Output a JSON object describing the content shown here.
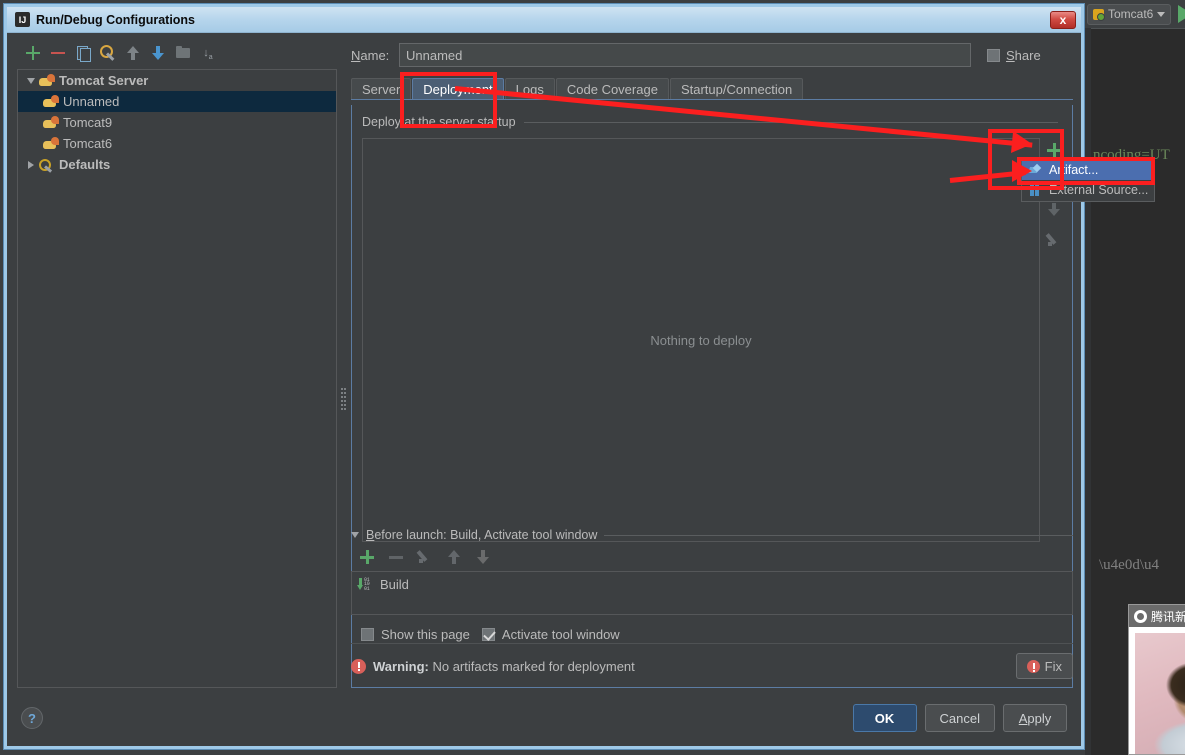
{
  "window": {
    "title": "Run/Debug Configurations",
    "icon": "intellij-idea-icon",
    "close_label": "x"
  },
  "ide_background": {
    "run_config_name": "Tomcat6",
    "run_button": "run-icon",
    "code_lines": [
      {
        "text": "ncoding=UT",
        "color": "#6a8759"
      },
      {
        "text": "\\u4e0d\\u4",
        "color": "#808080"
      }
    ]
  },
  "news_popup": {
    "title": "腾讯新",
    "logo": "tencent-news-logo"
  },
  "left_panel": {
    "toolbar": [
      {
        "name": "add-configuration-button",
        "icon": "plus-icon"
      },
      {
        "name": "remove-configuration-button",
        "icon": "minus-icon"
      },
      {
        "name": "copy-configuration-button",
        "icon": "copy-icon"
      },
      {
        "name": "edit-defaults-button",
        "icon": "wrench-icon"
      },
      {
        "name": "move-up-button",
        "icon": "arrow-up-icon"
      },
      {
        "name": "move-down-button",
        "icon": "arrow-down-icon"
      },
      {
        "name": "create-folder-button",
        "icon": "folder-icon"
      },
      {
        "name": "sort-configurations-button",
        "icon": "sort-az-icon"
      }
    ],
    "tree": [
      {
        "label": "Tomcat Server",
        "icon": "tomcat-icon",
        "level": 0,
        "expanded": true,
        "group": true,
        "selected": false
      },
      {
        "label": "Unnamed",
        "icon": "tomcat-icon",
        "level": 1,
        "group": false,
        "selected": true
      },
      {
        "label": "Tomcat9",
        "icon": "tomcat-icon",
        "level": 1,
        "group": false,
        "selected": false
      },
      {
        "label": "Tomcat6",
        "icon": "tomcat-icon",
        "level": 1,
        "group": false,
        "selected": false
      },
      {
        "label": "Defaults",
        "icon": "wrench-icon",
        "level": 0,
        "expanded": false,
        "group": true,
        "selected": false
      }
    ]
  },
  "form": {
    "name_label_pre": "N",
    "name_label_post": "ame:",
    "name_value": "Unnamed",
    "name_placeholder": "Unnamed",
    "share_label_pre": "S",
    "share_label_post": "hare",
    "share_checked": false
  },
  "tabs": [
    {
      "label": "Server",
      "active": false
    },
    {
      "label": "Deployment",
      "active": true
    },
    {
      "label": "Logs",
      "active": false
    },
    {
      "label": "Code Coverage",
      "active": false
    },
    {
      "label": "Startup/Connection",
      "active": false
    }
  ],
  "deployment": {
    "section_title": "Deploy at the server startup",
    "empty_text": "Nothing to deploy",
    "side_toolbar": [
      {
        "name": "add-artifact-button",
        "icon": "plus-icon",
        "enabled": true
      },
      {
        "name": "remove-artifact-button",
        "icon": "minus-icon",
        "enabled": false
      },
      {
        "name": "move-down-button",
        "icon": "arrow-down-icon",
        "enabled": false
      },
      {
        "name": "edit-artifact-button",
        "icon": "pencil-icon",
        "enabled": false
      }
    ]
  },
  "popup_menu": {
    "items": [
      {
        "label": "Artifact...",
        "icon": "artifact-icon",
        "highlighted": true
      },
      {
        "label": "External Source...",
        "icon": "external-source-icon",
        "highlighted": false
      }
    ]
  },
  "before_launch": {
    "title_pre": "B",
    "title_post": "efore launch: Build, Activate tool window",
    "toolbar": [
      {
        "name": "add-task-button",
        "icon": "plus-icon",
        "enabled": true
      },
      {
        "name": "remove-task-button",
        "icon": "minus-icon",
        "enabled": false
      },
      {
        "name": "edit-task-button",
        "icon": "pencil-icon",
        "enabled": false
      },
      {
        "name": "move-task-up-button",
        "icon": "arrow-up-icon",
        "enabled": false
      },
      {
        "name": "move-task-down-button",
        "icon": "arrow-down-icon",
        "enabled": false
      }
    ],
    "tasks": [
      {
        "label": "Build",
        "icon": "build-icon"
      }
    ],
    "checkboxes": [
      {
        "label": "Show this page",
        "checked": false
      },
      {
        "label": "Activate tool window",
        "checked": true
      }
    ]
  },
  "warning": {
    "prefix": "Warning:",
    "message": "No artifacts marked for deployment",
    "fix_label": "Fix"
  },
  "buttons": {
    "help": "?",
    "ok": "OK",
    "cancel": "Cancel",
    "apply_pre": "A",
    "apply_post": "pply"
  },
  "colors": {
    "accent_blue": "#4b6eaf",
    "annotation_red": "#fb1f1f",
    "green_plus": "#59a869",
    "warning_red": "#d9605a",
    "titlebar_blue": "#b6d5ec"
  }
}
